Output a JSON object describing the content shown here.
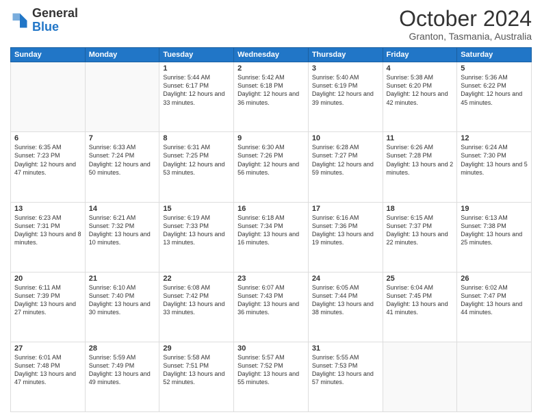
{
  "header": {
    "logo_general": "General",
    "logo_blue": "Blue",
    "month_title": "October 2024",
    "location": "Granton, Tasmania, Australia"
  },
  "days_of_week": [
    "Sunday",
    "Monday",
    "Tuesday",
    "Wednesday",
    "Thursday",
    "Friday",
    "Saturday"
  ],
  "weeks": [
    [
      {
        "day": "",
        "sunrise": "",
        "sunset": "",
        "daylight": ""
      },
      {
        "day": "",
        "sunrise": "",
        "sunset": "",
        "daylight": ""
      },
      {
        "day": "1",
        "sunrise": "Sunrise: 5:44 AM",
        "sunset": "Sunset: 6:17 PM",
        "daylight": "Daylight: 12 hours and 33 minutes."
      },
      {
        "day": "2",
        "sunrise": "Sunrise: 5:42 AM",
        "sunset": "Sunset: 6:18 PM",
        "daylight": "Daylight: 12 hours and 36 minutes."
      },
      {
        "day": "3",
        "sunrise": "Sunrise: 5:40 AM",
        "sunset": "Sunset: 6:19 PM",
        "daylight": "Daylight: 12 hours and 39 minutes."
      },
      {
        "day": "4",
        "sunrise": "Sunrise: 5:38 AM",
        "sunset": "Sunset: 6:20 PM",
        "daylight": "Daylight: 12 hours and 42 minutes."
      },
      {
        "day": "5",
        "sunrise": "Sunrise: 5:36 AM",
        "sunset": "Sunset: 6:22 PM",
        "daylight": "Daylight: 12 hours and 45 minutes."
      }
    ],
    [
      {
        "day": "6",
        "sunrise": "Sunrise: 6:35 AM",
        "sunset": "Sunset: 7:23 PM",
        "daylight": "Daylight: 12 hours and 47 minutes."
      },
      {
        "day": "7",
        "sunrise": "Sunrise: 6:33 AM",
        "sunset": "Sunset: 7:24 PM",
        "daylight": "Daylight: 12 hours and 50 minutes."
      },
      {
        "day": "8",
        "sunrise": "Sunrise: 6:31 AM",
        "sunset": "Sunset: 7:25 PM",
        "daylight": "Daylight: 12 hours and 53 minutes."
      },
      {
        "day": "9",
        "sunrise": "Sunrise: 6:30 AM",
        "sunset": "Sunset: 7:26 PM",
        "daylight": "Daylight: 12 hours and 56 minutes."
      },
      {
        "day": "10",
        "sunrise": "Sunrise: 6:28 AM",
        "sunset": "Sunset: 7:27 PM",
        "daylight": "Daylight: 12 hours and 59 minutes."
      },
      {
        "day": "11",
        "sunrise": "Sunrise: 6:26 AM",
        "sunset": "Sunset: 7:28 PM",
        "daylight": "Daylight: 13 hours and 2 minutes."
      },
      {
        "day": "12",
        "sunrise": "Sunrise: 6:24 AM",
        "sunset": "Sunset: 7:30 PM",
        "daylight": "Daylight: 13 hours and 5 minutes."
      }
    ],
    [
      {
        "day": "13",
        "sunrise": "Sunrise: 6:23 AM",
        "sunset": "Sunset: 7:31 PM",
        "daylight": "Daylight: 13 hours and 8 minutes."
      },
      {
        "day": "14",
        "sunrise": "Sunrise: 6:21 AM",
        "sunset": "Sunset: 7:32 PM",
        "daylight": "Daylight: 13 hours and 10 minutes."
      },
      {
        "day": "15",
        "sunrise": "Sunrise: 6:19 AM",
        "sunset": "Sunset: 7:33 PM",
        "daylight": "Daylight: 13 hours and 13 minutes."
      },
      {
        "day": "16",
        "sunrise": "Sunrise: 6:18 AM",
        "sunset": "Sunset: 7:34 PM",
        "daylight": "Daylight: 13 hours and 16 minutes."
      },
      {
        "day": "17",
        "sunrise": "Sunrise: 6:16 AM",
        "sunset": "Sunset: 7:36 PM",
        "daylight": "Daylight: 13 hours and 19 minutes."
      },
      {
        "day": "18",
        "sunrise": "Sunrise: 6:15 AM",
        "sunset": "Sunset: 7:37 PM",
        "daylight": "Daylight: 13 hours and 22 minutes."
      },
      {
        "day": "19",
        "sunrise": "Sunrise: 6:13 AM",
        "sunset": "Sunset: 7:38 PM",
        "daylight": "Daylight: 13 hours and 25 minutes."
      }
    ],
    [
      {
        "day": "20",
        "sunrise": "Sunrise: 6:11 AM",
        "sunset": "Sunset: 7:39 PM",
        "daylight": "Daylight: 13 hours and 27 minutes."
      },
      {
        "day": "21",
        "sunrise": "Sunrise: 6:10 AM",
        "sunset": "Sunset: 7:40 PM",
        "daylight": "Daylight: 13 hours and 30 minutes."
      },
      {
        "day": "22",
        "sunrise": "Sunrise: 6:08 AM",
        "sunset": "Sunset: 7:42 PM",
        "daylight": "Daylight: 13 hours and 33 minutes."
      },
      {
        "day": "23",
        "sunrise": "Sunrise: 6:07 AM",
        "sunset": "Sunset: 7:43 PM",
        "daylight": "Daylight: 13 hours and 36 minutes."
      },
      {
        "day": "24",
        "sunrise": "Sunrise: 6:05 AM",
        "sunset": "Sunset: 7:44 PM",
        "daylight": "Daylight: 13 hours and 38 minutes."
      },
      {
        "day": "25",
        "sunrise": "Sunrise: 6:04 AM",
        "sunset": "Sunset: 7:45 PM",
        "daylight": "Daylight: 13 hours and 41 minutes."
      },
      {
        "day": "26",
        "sunrise": "Sunrise: 6:02 AM",
        "sunset": "Sunset: 7:47 PM",
        "daylight": "Daylight: 13 hours and 44 minutes."
      }
    ],
    [
      {
        "day": "27",
        "sunrise": "Sunrise: 6:01 AM",
        "sunset": "Sunset: 7:48 PM",
        "daylight": "Daylight: 13 hours and 47 minutes."
      },
      {
        "day": "28",
        "sunrise": "Sunrise: 5:59 AM",
        "sunset": "Sunset: 7:49 PM",
        "daylight": "Daylight: 13 hours and 49 minutes."
      },
      {
        "day": "29",
        "sunrise": "Sunrise: 5:58 AM",
        "sunset": "Sunset: 7:51 PM",
        "daylight": "Daylight: 13 hours and 52 minutes."
      },
      {
        "day": "30",
        "sunrise": "Sunrise: 5:57 AM",
        "sunset": "Sunset: 7:52 PM",
        "daylight": "Daylight: 13 hours and 55 minutes."
      },
      {
        "day": "31",
        "sunrise": "Sunrise: 5:55 AM",
        "sunset": "Sunset: 7:53 PM",
        "daylight": "Daylight: 13 hours and 57 minutes."
      },
      {
        "day": "",
        "sunrise": "",
        "sunset": "",
        "daylight": ""
      },
      {
        "day": "",
        "sunrise": "",
        "sunset": "",
        "daylight": ""
      }
    ]
  ]
}
